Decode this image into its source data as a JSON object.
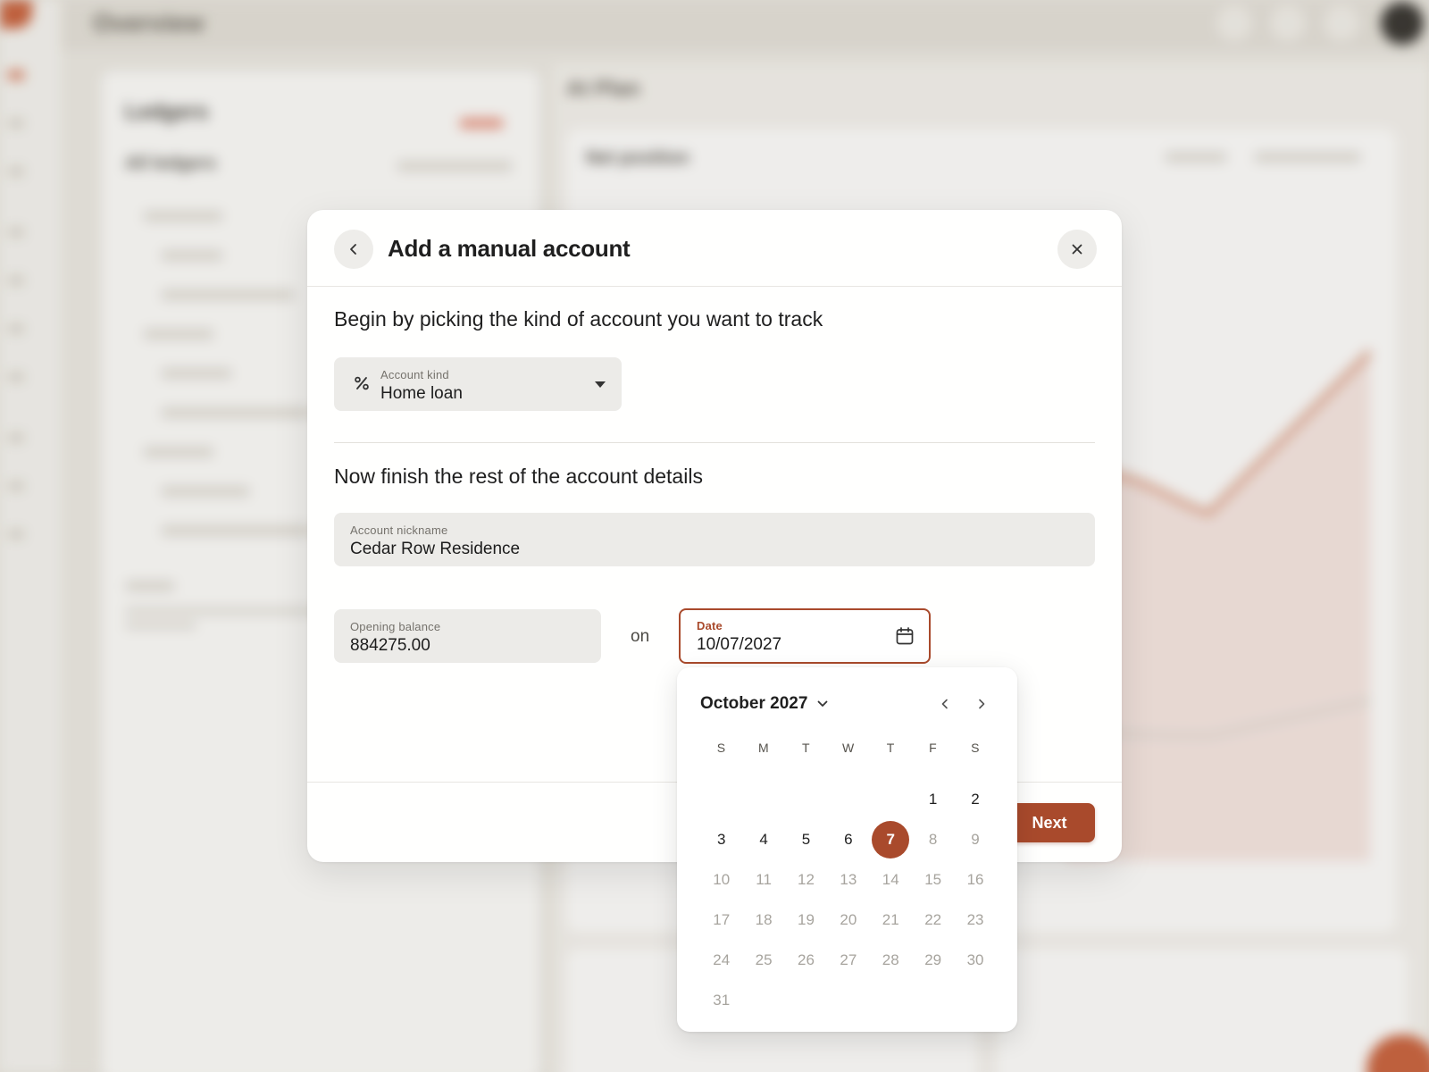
{
  "colors": {
    "accent": "#a94a2c",
    "field_bg": "#ecebe8",
    "muted_day": "#a7a49e"
  },
  "background": {
    "title": "Overview",
    "left_panel_heading": "Ledgers",
    "left_panel_subheading": "All ledgers",
    "right_panel_title": "At Plan",
    "chart_card_title": "Net position"
  },
  "modal": {
    "title": "Add a manual account",
    "back_icon": "chevron-left-icon",
    "close_icon": "close-icon",
    "step1_heading": "Begin by picking the kind of account you want to track",
    "account_kind": {
      "label": "Account kind",
      "value": "Home loan",
      "icon": "percent-icon"
    },
    "step2_heading": "Now finish the rest of the account details",
    "nickname": {
      "label": "Account nickname",
      "value": "Cedar Row Residence"
    },
    "balance": {
      "label": "Opening balance",
      "value": "884275.00"
    },
    "on_text": "on",
    "date": {
      "label": "Date",
      "value": "10/07/2027",
      "icon": "calendar-icon"
    },
    "next_label": "Next"
  },
  "calendar": {
    "month_label": "October 2027",
    "weekdays": [
      "S",
      "M",
      "T",
      "W",
      "T",
      "F",
      "S"
    ],
    "selected_day": 7,
    "weeks": [
      [
        "",
        "",
        "",
        "",
        "",
        "1",
        "2"
      ],
      [
        "3",
        "4",
        "5",
        "6",
        "7",
        "8",
        "9"
      ],
      [
        "10",
        "11",
        "12",
        "13",
        "14",
        "15",
        "16"
      ],
      [
        "17",
        "18",
        "19",
        "20",
        "21",
        "22",
        "23"
      ],
      [
        "24",
        "25",
        "26",
        "27",
        "28",
        "29",
        "30"
      ],
      [
        "31",
        "",
        "",
        "",
        "",
        "",
        ""
      ]
    ]
  }
}
